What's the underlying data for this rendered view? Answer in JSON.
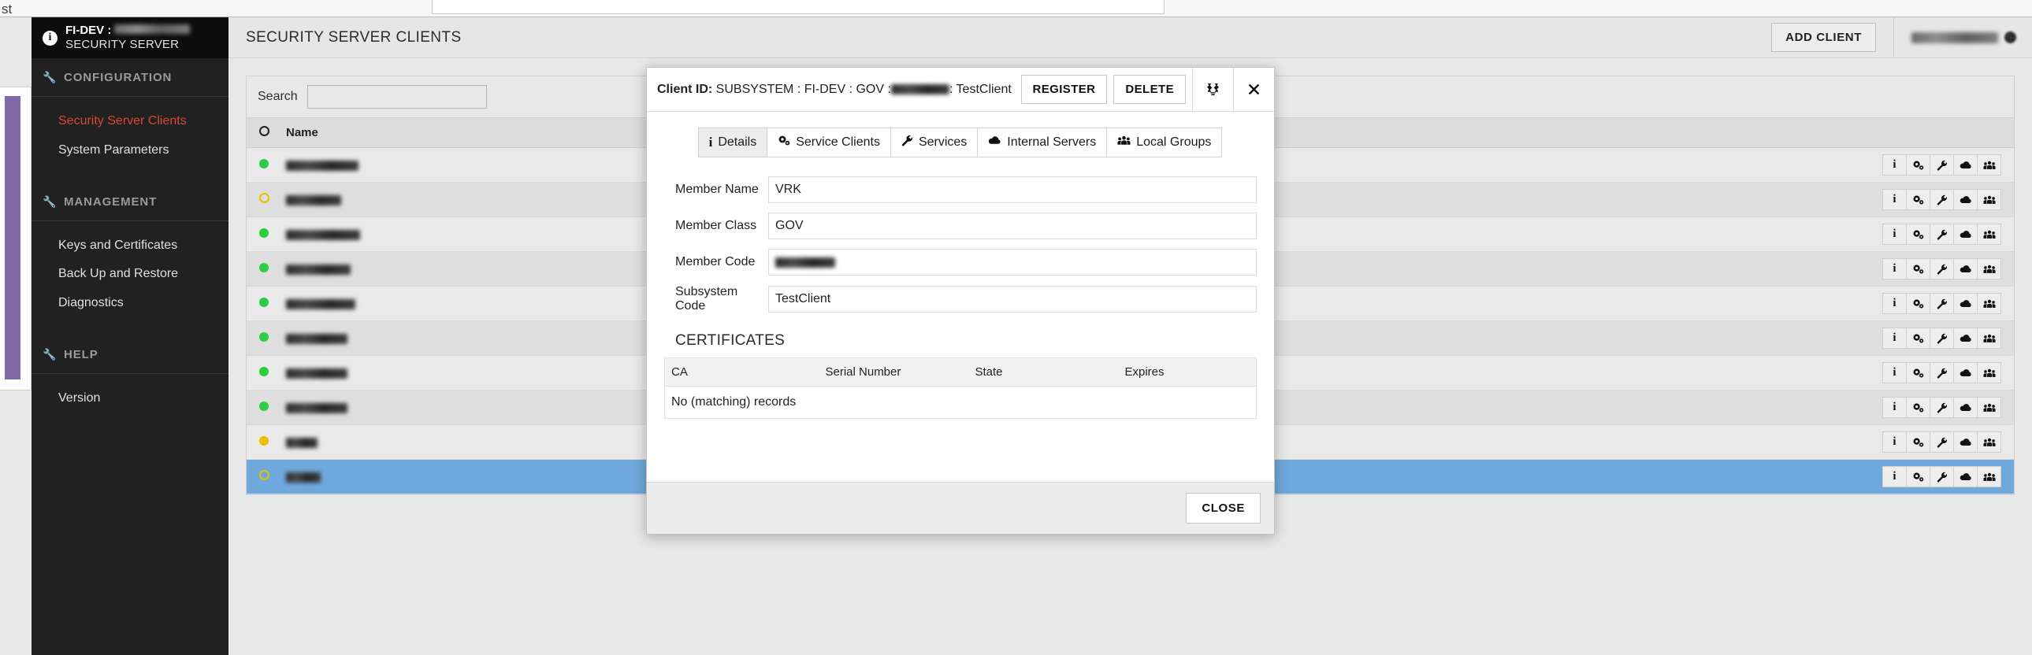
{
  "window": {
    "top_left_text": "st"
  },
  "sidebar": {
    "brand": {
      "line1_prefix": "FI-DEV :",
      "line1_redacted": true,
      "line2": "SECURITY SERVER",
      "icon": "info-icon"
    },
    "sections": [
      {
        "label": "CONFIGURATION",
        "icon": "wrench-icon",
        "items": [
          {
            "label": "Security Server Clients",
            "active": true
          },
          {
            "label": "System Parameters",
            "active": false
          }
        ]
      },
      {
        "label": "MANAGEMENT",
        "icon": "wrench-icon",
        "items": [
          {
            "label": "Keys and Certificates",
            "active": false
          },
          {
            "label": "Back Up and Restore",
            "active": false
          },
          {
            "label": "Diagnostics",
            "active": false
          }
        ]
      },
      {
        "label": "HELP",
        "icon": "wrench-icon",
        "items": [
          {
            "label": "Version",
            "active": false
          }
        ]
      }
    ]
  },
  "header": {
    "title": "SECURITY SERVER CLIENTS",
    "add_client_label": "ADD CLIENT",
    "user_name_redacted": true,
    "user_avatar": "user-dot-icon"
  },
  "clients_panel": {
    "search_label": "Search",
    "search_value": "",
    "search_placeholder": "",
    "columns": [
      "",
      "Name",
      ""
    ],
    "status_header_icon": "circle-outline-icon",
    "row_actions": [
      {
        "name": "info-icon",
        "title": "Details"
      },
      {
        "name": "gears-icon",
        "title": "Service Clients"
      },
      {
        "name": "wrench-icon",
        "title": "Services"
      },
      {
        "name": "cloud-icon",
        "title": "Internal Servers"
      },
      {
        "name": "people-icon",
        "title": "Local Groups"
      }
    ],
    "rows": [
      {
        "status": "green",
        "name_redacted": true,
        "name_width": 92,
        "selected": false
      },
      {
        "status": "yellow-hollow",
        "name_redacted": true,
        "name_width": 70,
        "selected": false
      },
      {
        "status": "green",
        "name_redacted": true,
        "name_width": 94,
        "selected": false
      },
      {
        "status": "green",
        "name_redacted": true,
        "name_width": 82,
        "selected": false
      },
      {
        "status": "green",
        "name_redacted": true,
        "name_width": 88,
        "selected": false
      },
      {
        "status": "green",
        "name_redacted": true,
        "name_width": 78,
        "selected": false
      },
      {
        "status": "green",
        "name_redacted": true,
        "name_width": 78,
        "selected": false
      },
      {
        "status": "green",
        "name_redacted": true,
        "name_width": 78,
        "selected": false
      },
      {
        "status": "yellow",
        "name_redacted": true,
        "name_width": 40,
        "selected": false
      },
      {
        "status": "yellow-hollow",
        "name_redacted": true,
        "name_width": 44,
        "selected": true
      }
    ]
  },
  "modal": {
    "title_label": "Client ID:",
    "title_value_prefix": "SUBSYSTEM : FI-DEV : GOV : ",
    "title_value_suffix": " : TestClient",
    "title_redacted": true,
    "register_label": "REGISTER",
    "delete_label": "DELETE",
    "expand_icon": "expand-icon",
    "close_icon": "close-icon",
    "tabs": [
      {
        "label": "Details",
        "icon": "info-icon",
        "active": true
      },
      {
        "label": "Service Clients",
        "icon": "gears-icon",
        "active": false
      },
      {
        "label": "Services",
        "icon": "wrench-icon",
        "active": false
      },
      {
        "label": "Internal Servers",
        "icon": "cloud-icon",
        "active": false
      },
      {
        "label": "Local Groups",
        "icon": "people-icon",
        "active": false
      }
    ],
    "fields": [
      {
        "label": "Member Name",
        "value": "VRK",
        "redacted": false
      },
      {
        "label": "Member Class",
        "value": "GOV",
        "redacted": false
      },
      {
        "label": "Member Code",
        "value": "",
        "redacted": true
      },
      {
        "label": "Subsystem Code",
        "value": "TestClient",
        "redacted": false
      }
    ],
    "certificates": {
      "section_title": "CERTIFICATES",
      "columns": [
        "CA",
        "Serial Number",
        "State",
        "Expires"
      ],
      "empty_message": "No (matching) records",
      "rows": []
    },
    "close_label": "CLOSE"
  },
  "colors": {
    "sidebar_bg": "#212121",
    "brand_bg": "#0d0d0d",
    "active_item": "#d74935",
    "selected_row": "#6fa8dc",
    "status_green": "#2ecc40",
    "status_yellow": "#e6c100",
    "purple_sliver": "#8169a8"
  }
}
